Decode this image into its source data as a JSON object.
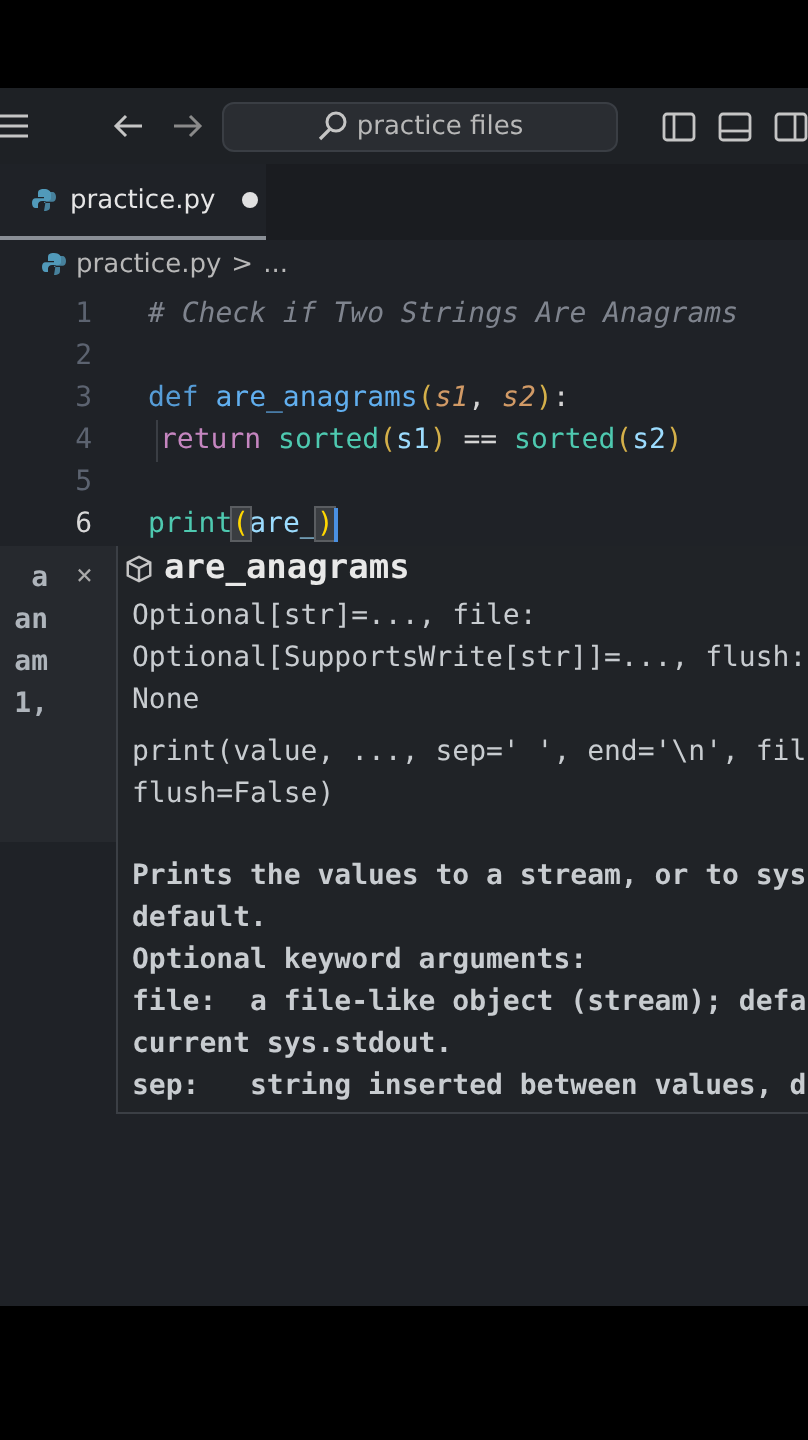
{
  "title_bar": {
    "search": {
      "label": "practice files"
    }
  },
  "tabs": [
    {
      "label": "practice.py",
      "selected": true,
      "modified": true
    }
  ],
  "breadcrumb": {
    "file": "practice.py",
    "separator": ">",
    "rest": "..."
  },
  "editor": {
    "lines": [
      {
        "number": "1",
        "current": false,
        "tokens": [
          {
            "kind": "comment",
            "text": "# Check if Two Strings Are Anagrams"
          }
        ]
      },
      {
        "number": "2",
        "current": false
      },
      {
        "number": "3",
        "current": false,
        "tokens": [
          {
            "kind": "keyword",
            "text": "def "
          },
          {
            "kind": "function",
            "text": "are_anagrams"
          },
          {
            "kind": "bracket",
            "text": "("
          },
          {
            "kind": "param",
            "text": "s1"
          },
          {
            "kind": "plain",
            "text": ", "
          },
          {
            "kind": "param",
            "text": "s2"
          },
          {
            "kind": "bracket",
            "text": ")"
          },
          {
            "kind": "plain",
            "text": ":"
          }
        ]
      },
      {
        "number": "4",
        "current": false,
        "indented": true,
        "tokens": [
          {
            "kind": "control",
            "text": "return "
          },
          {
            "kind": "builtin",
            "text": "sorted"
          },
          {
            "kind": "bracket",
            "text": "("
          },
          {
            "kind": "variable",
            "text": "s1"
          },
          {
            "kind": "bracket",
            "text": ")"
          },
          {
            "kind": "plain",
            "text": " == "
          },
          {
            "kind": "builtin",
            "text": "sorted"
          },
          {
            "kind": "bracket",
            "text": "("
          },
          {
            "kind": "variable",
            "text": "s2"
          },
          {
            "kind": "bracket",
            "text": ")"
          }
        ]
      },
      {
        "number": "5",
        "current": false
      },
      {
        "number": "6",
        "current": true,
        "tokens": [
          {
            "kind": "builtin",
            "text": "print"
          },
          {
            "kind": "matched",
            "text": "("
          },
          {
            "kind": "variable",
            "text": "are_"
          },
          {
            "kind": "matched",
            "text": ")"
          }
        ]
      }
    ]
  },
  "side_panel": {
    "close": "×",
    "lines": [
      "a",
      "an",
      "am",
      "1,"
    ]
  },
  "suggestion": {
    "label": "are_anagrams",
    "sections": [
      {
        "kind": "signature",
        "lines": [
          "Optional[str]=..., file:",
          "Optional[SupportsWrite[str]]=..., flush:",
          "None"
        ]
      },
      {
        "kind": "signature",
        "lines": [
          "print(value, ..., sep=' ', end='\\n', fil",
          "flush=False)"
        ]
      },
      {
        "kind": "documentation",
        "lines": [
          "Prints the values to a stream, or to sys",
          "default.",
          "Optional keyword arguments:",
          "file:  a file-like object (stream); defa",
          "current sys.stdout.",
          "sep:   string inserted between values, d"
        ]
      }
    ]
  }
}
